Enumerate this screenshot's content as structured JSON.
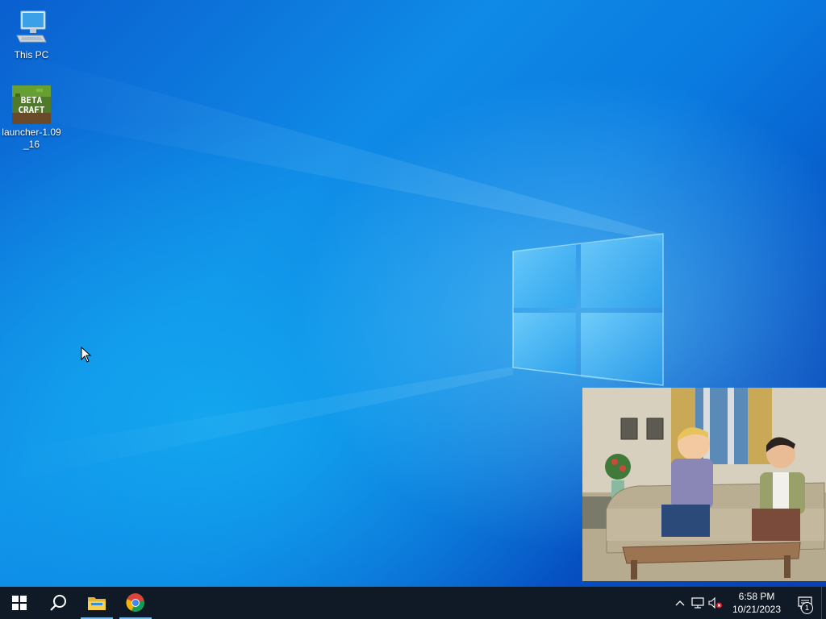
{
  "desktop": {
    "icons": [
      {
        "label": "This PC",
        "icon": "computer-icon"
      },
      {
        "label": "launcher-1.09_16",
        "icon": "betacraft-icon",
        "icon_text_line1": "BETA",
        "icon_text_line2": "CRAFT"
      }
    ]
  },
  "video_overlay": {
    "description_icon": "video-player",
    "content": "cartoon-living-room-scene"
  },
  "taskbar": {
    "start_icon": "windows-logo-icon",
    "search_icon": "search-icon",
    "pinned": [
      {
        "name": "File Explorer",
        "icon": "folder-icon",
        "active": true
      },
      {
        "name": "Google Chrome",
        "icon": "chrome-icon",
        "active": true
      }
    ],
    "tray": {
      "chevron_icon": "chevron-up-icon",
      "network_icon": "network-icon",
      "volume_icon": "volume-muted-icon",
      "time": "6:58 PM",
      "date": "10/21/2023",
      "notification_count": "1"
    }
  },
  "colors": {
    "taskbar": "#101a26",
    "accent": "#76b9ed",
    "desktop_blue": "#0a6fd6"
  }
}
